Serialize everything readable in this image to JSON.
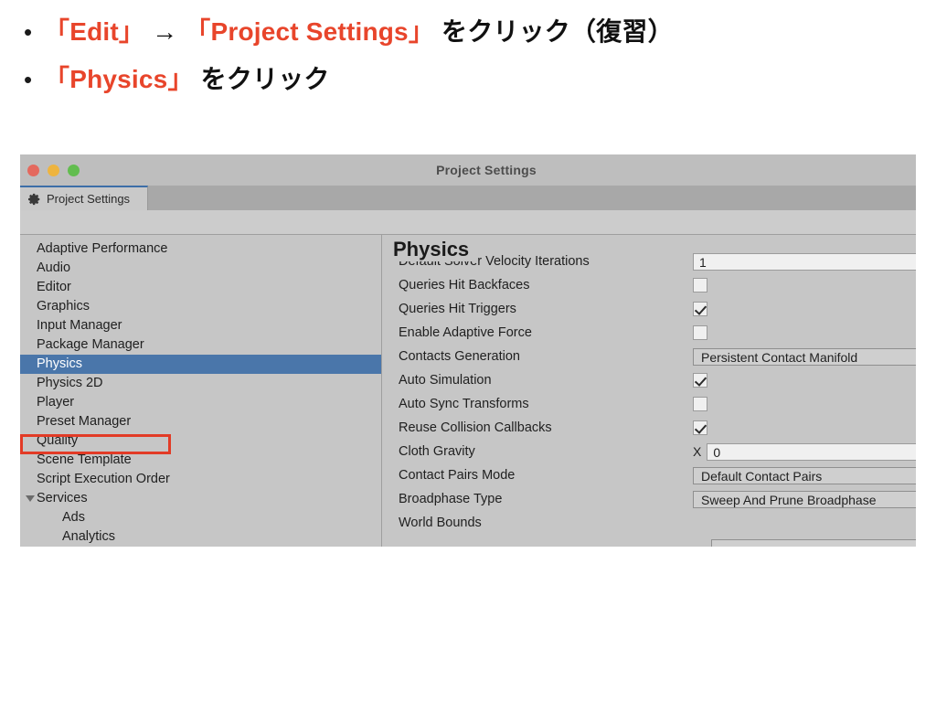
{
  "slide": {
    "bullets": [
      {
        "marker": "•",
        "segments": [
          {
            "text": "「Edit」",
            "accent": true
          },
          {
            "text": " → ",
            "accent": false
          },
          {
            "text": "「Project Settings」",
            "accent": true
          },
          {
            "text": " をクリック（復習）",
            "accent": false
          }
        ]
      },
      {
        "marker": "•",
        "segments": [
          {
            "text": "「Physics」",
            "accent": true
          },
          {
            "text": " をクリック",
            "accent": false
          }
        ]
      }
    ],
    "accent_color": "#e8452b",
    "text_color": "#111111"
  },
  "window": {
    "title": "Project Settings",
    "traffic_lights": [
      "close-red",
      "minimize-yellow",
      "zoom-green"
    ],
    "tab": {
      "label": "Project Settings",
      "icon": "gear-icon"
    }
  },
  "sidebar": {
    "items": [
      {
        "label": "Adaptive Performance",
        "selected": false,
        "child": false,
        "expandable": false
      },
      {
        "label": "Audio",
        "selected": false,
        "child": false,
        "expandable": false
      },
      {
        "label": "Editor",
        "selected": false,
        "child": false,
        "expandable": false
      },
      {
        "label": "Graphics",
        "selected": false,
        "child": false,
        "expandable": false
      },
      {
        "label": "Input Manager",
        "selected": false,
        "child": false,
        "expandable": false
      },
      {
        "label": "Package Manager",
        "selected": false,
        "child": false,
        "expandable": false
      },
      {
        "label": "Physics",
        "selected": true,
        "child": false,
        "expandable": false
      },
      {
        "label": "Physics 2D",
        "selected": false,
        "child": false,
        "expandable": false
      },
      {
        "label": "Player",
        "selected": false,
        "child": false,
        "expandable": false
      },
      {
        "label": "Preset Manager",
        "selected": false,
        "child": false,
        "expandable": false
      },
      {
        "label": "Quality",
        "selected": false,
        "child": false,
        "expandable": false
      },
      {
        "label": "Scene Template",
        "selected": false,
        "child": false,
        "expandable": false
      },
      {
        "label": "Script Execution Order",
        "selected": false,
        "child": false,
        "expandable": false
      },
      {
        "label": "Services",
        "selected": false,
        "child": false,
        "expandable": true
      },
      {
        "label": "Ads",
        "selected": false,
        "child": true,
        "expandable": false
      },
      {
        "label": "Analytics",
        "selected": false,
        "child": true,
        "expandable": false
      }
    ],
    "selection_color": "#4a76aa",
    "annotation_box_color": "#e23b26"
  },
  "detail": {
    "title": "Physics",
    "rows": [
      {
        "label": "Default Solver Velocity Iterations",
        "type": "number",
        "value": "1",
        "clipped": true
      },
      {
        "label": "Queries Hit Backfaces",
        "type": "checkbox",
        "checked": false
      },
      {
        "label": "Queries Hit Triggers",
        "type": "checkbox",
        "checked": true
      },
      {
        "label": "Enable Adaptive Force",
        "type": "checkbox",
        "checked": false
      },
      {
        "label": "Contacts Generation",
        "type": "dropdown",
        "value": "Persistent Contact Manifold"
      },
      {
        "label": "Auto Simulation",
        "type": "checkbox",
        "checked": true
      },
      {
        "label": "Auto Sync Transforms",
        "type": "checkbox",
        "checked": false
      },
      {
        "label": "Reuse Collision Callbacks",
        "type": "checkbox",
        "checked": true
      },
      {
        "label": "Cloth Gravity",
        "type": "vector",
        "axis": "X",
        "value": "0"
      },
      {
        "label": "Contact Pairs Mode",
        "type": "dropdown",
        "value": "Default Contact Pairs"
      },
      {
        "label": "Broadphase Type",
        "type": "dropdown",
        "value": "Sweep And Prune Broadphase"
      },
      {
        "label": "World Bounds",
        "type": "none",
        "value": ""
      }
    ]
  }
}
